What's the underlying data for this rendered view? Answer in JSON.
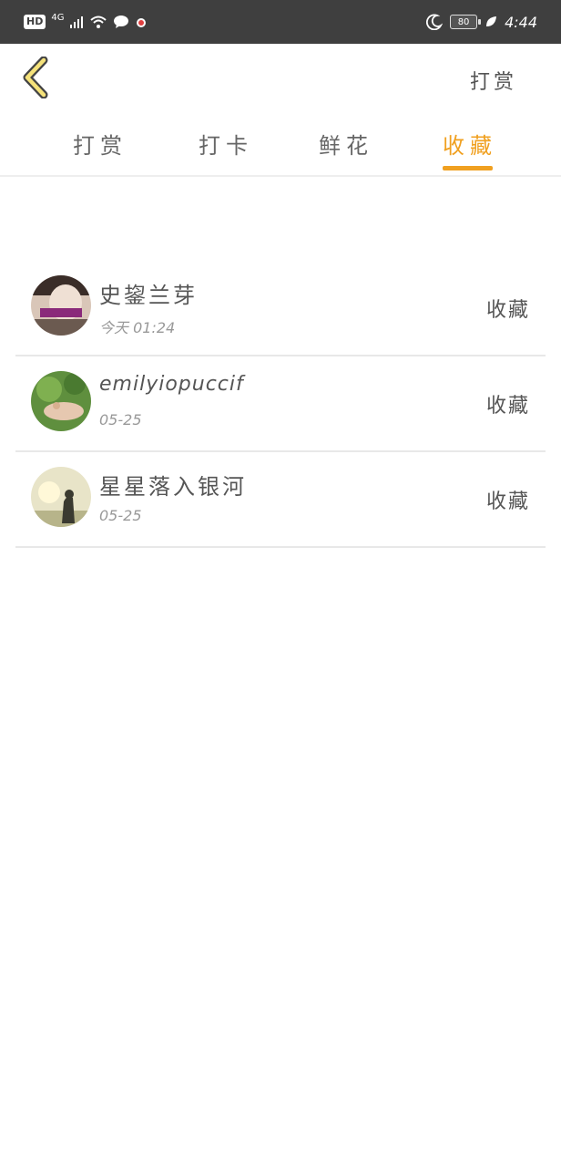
{
  "status_bar": {
    "left_badge": "HD",
    "network": "4G",
    "battery": "80",
    "time": "4:44"
  },
  "header": {
    "back_icon": "chevron-left-icon",
    "right_link": "打赏"
  },
  "tabs": [
    {
      "label": "打赏",
      "active": false
    },
    {
      "label": "打卡",
      "active": false
    },
    {
      "label": "鲜花",
      "active": false
    },
    {
      "label": "收藏",
      "active": true
    }
  ],
  "colors": {
    "accent": "#f0a020",
    "status_bar_bg": "#3f3f3f"
  },
  "list": [
    {
      "name": "史鋆兰芽",
      "time": "今天 01:24",
      "action": "收藏"
    },
    {
      "name": "emilyiopuccif",
      "time": "05-25",
      "action": "收藏"
    },
    {
      "name": "星星落入银河",
      "time": "05-25",
      "action": "收藏"
    }
  ]
}
